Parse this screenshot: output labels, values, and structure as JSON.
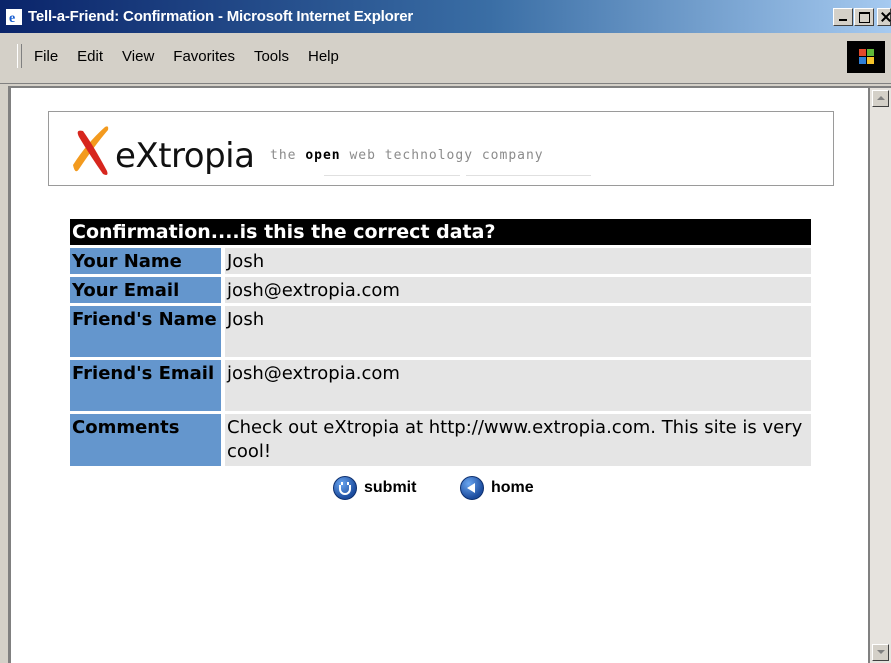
{
  "window": {
    "title": "Tell-a-Friend: Confirmation - Microsoft Internet Explorer"
  },
  "menu": {
    "items": [
      "File",
      "Edit",
      "View",
      "Favorites",
      "Tools",
      "Help"
    ]
  },
  "banner": {
    "brand": "eXtropia",
    "tagline_pre": "the ",
    "tagline_bold": "open",
    "tagline_post": " web technology company"
  },
  "confirmation": {
    "header": "Confirmation....is this the correct data?",
    "rows": [
      {
        "label": "Your Name",
        "value": "Josh"
      },
      {
        "label": "Your Email",
        "value": "josh@extropia.com"
      },
      {
        "label": "Friend's Name",
        "value": "Josh"
      },
      {
        "label": "Friend's Email",
        "value": "josh@extropia.com"
      },
      {
        "label": "Comments",
        "value": "Check out eXtropia at http://www.extropia.com. This site is very cool!"
      }
    ]
  },
  "actions": {
    "submit_label": "submit",
    "home_label": "home"
  },
  "colors": {
    "label_bg": "#6496cd",
    "value_bg": "#e5e5e5",
    "header_bg": "#000000"
  }
}
